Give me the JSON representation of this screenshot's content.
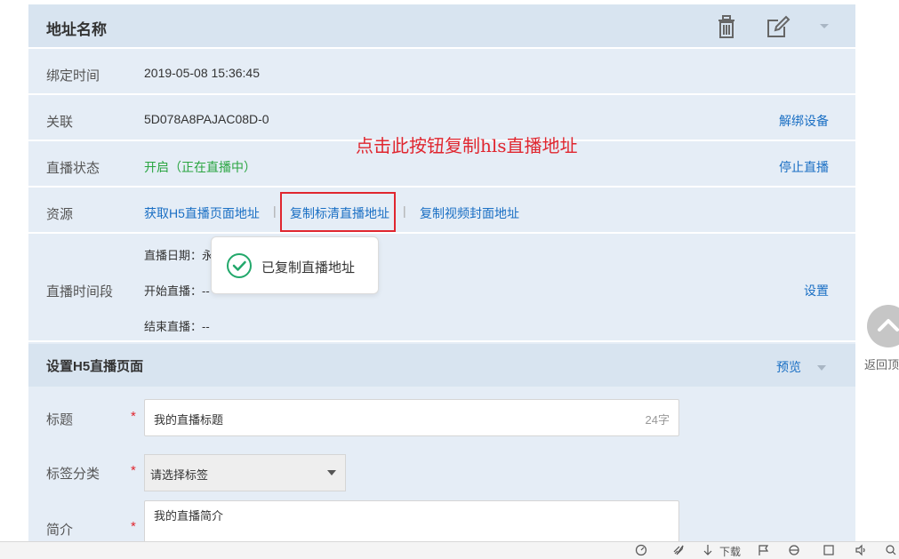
{
  "header": {
    "title": "地址名称",
    "delete_icon": "trash-icon",
    "edit_icon": "edit-icon",
    "collapse_icon": "chevron-down-icon"
  },
  "bind_time": {
    "label": "绑定时间",
    "value": "2019-05-08 15:36:45"
  },
  "association": {
    "label": "关联",
    "value": "5D078A8PAJAC08D-0",
    "action": "解绑设备"
  },
  "live_status": {
    "label": "直播状态",
    "value": "开启（正在直播中）",
    "action": "停止直播",
    "status_color": "#2aa541"
  },
  "resources": {
    "label": "资源",
    "links": [
      "获取H5直播页面地址",
      "复制标清直播地址",
      "复制视频封面地址"
    ],
    "separator": "|"
  },
  "annotation": "点击此按钮复制hls直播地址",
  "toast": {
    "message": "已复制直播地址",
    "icon": "check-circle-icon"
  },
  "live_period": {
    "label": "直播时间段",
    "date": "直播日期：永久",
    "start": "开始直播：--",
    "end": "结束直播：--",
    "action": "设置"
  },
  "h5_settings": {
    "title": "设置H5直播页面",
    "preview": "预览"
  },
  "form": {
    "title_label": "标题",
    "title_value": "我的直播标题",
    "title_count": "24字",
    "tag_label": "标签分类",
    "tag_placeholder": "请选择标签",
    "intro_label": "简介",
    "intro_value": "我的直播简介",
    "required_mark": "*"
  },
  "back_to_top": {
    "label": "返回顶"
  },
  "statusbar": {
    "download": "下载"
  },
  "colors": {
    "accent": "#1a6fc4",
    "highlight": "#e0262f",
    "panel_bg": "#e5edf6",
    "header_bg": "#d8e4f0"
  }
}
